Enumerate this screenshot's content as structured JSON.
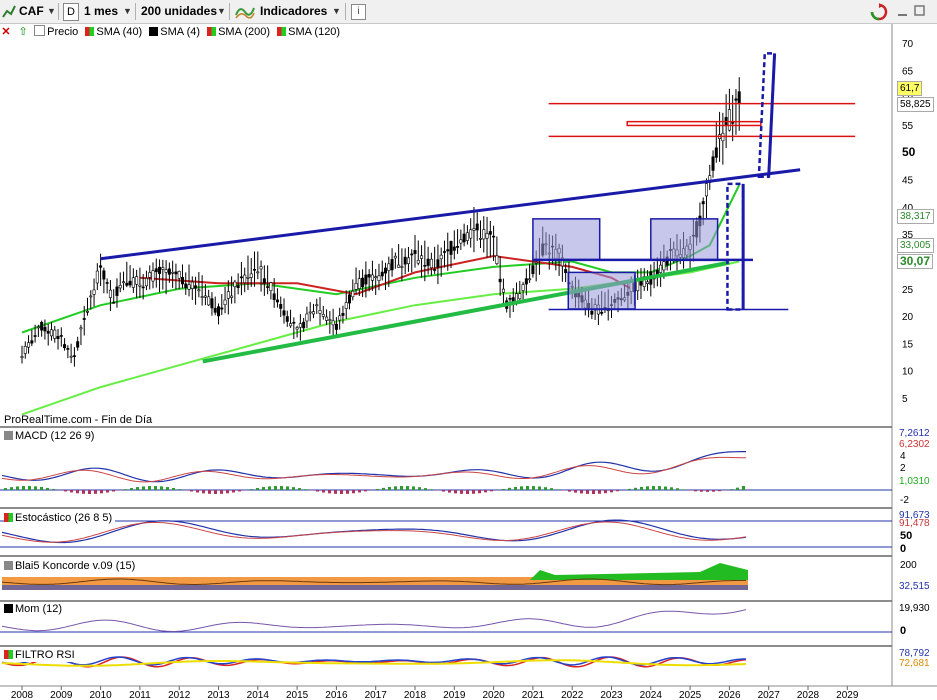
{
  "toolbar": {
    "symbol": "CAF",
    "period_letter": "D",
    "timeframe": "1 mes",
    "units": "200 unidades",
    "indicators_label": "Indicadores",
    "info_icon": "info-icon"
  },
  "legend": {
    "price": "Precio",
    "sma40": "SMA (40)",
    "sma4": "SMA (4)",
    "sma200": "SMA (200)",
    "sma120": "SMA (120)"
  },
  "watermark": "ProRealTime.com - Fin de Día",
  "panels": {
    "macd": {
      "title": "MACD (12 26 9)",
      "v1": "7,2612",
      "v2": "6,2302",
      "v3": "1,0310",
      "ticks": [
        "4",
        "2",
        "0",
        "-2"
      ]
    },
    "stoch": {
      "title": "Estocástico (26 8 5)",
      "v1": "91,673",
      "v2": "91,478",
      "ticks": [
        "50",
        "0"
      ]
    },
    "konc": {
      "title": "Blai5 Koncorde v.09 (15)",
      "v1": "32,515",
      "ticks": [
        "200",
        "0"
      ]
    },
    "mom": {
      "title": "Mom (12)",
      "v1": "19,930",
      "ticks": [
        "0"
      ]
    },
    "rsi": {
      "title": "FILTRO RSI",
      "v1": "78,792",
      "v2": "72,681"
    }
  },
  "colors": {
    "price_bar": "#000000",
    "sma40": "#22cc22",
    "sma200": "#66ee44",
    "sma120": "#cc2222",
    "trend": "#1a1aa8",
    "resistance": "#dd1111",
    "box": "#9999dd",
    "last_price_bg": "#ffff66"
  },
  "chart_data": {
    "type": "line",
    "title": "",
    "y_axis_ticks": [
      5,
      10,
      15,
      20,
      25,
      30,
      35,
      40,
      45,
      50,
      55,
      60,
      65,
      70
    ],
    "ylim": [
      0,
      72
    ],
    "x_axis_years": [
      "2008",
      "2009",
      "2010",
      "2011",
      "2012",
      "2013",
      "2014",
      "2015",
      "2016",
      "2017",
      "2018",
      "2019",
      "2020",
      "2021",
      "2022",
      "2023",
      "2024",
      "2025",
      "2026",
      "2027",
      "2028",
      "2029"
    ],
    "last_price": "61,7",
    "price_labels": [
      "58,825",
      "38,317",
      "33,005",
      "30,07"
    ],
    "series": [
      {
        "name": "Precio",
        "x": [
          2008.0,
          2008.5,
          2009.0,
          2009.3,
          2009.7,
          2010.0,
          2010.3,
          2010.6,
          2011.0,
          2011.5,
          2012.0,
          2012.5,
          2013.0,
          2013.5,
          2014.0,
          2014.5,
          2015.0,
          2015.5,
          2016.0,
          2016.5,
          2017.0,
          2017.5,
          2018.0,
          2018.5,
          2019.0,
          2019.5,
          2020.0,
          2020.3,
          2020.7,
          2021.0,
          2021.3,
          2021.7,
          2022.0,
          2022.5,
          2023.0,
          2023.5,
          2024.0,
          2024.5,
          2025.0,
          2025.3,
          2025.6,
          2026.0,
          2026.25
        ],
        "y": [
          13,
          18,
          16,
          12,
          22,
          29,
          23,
          27,
          26,
          28,
          27,
          25,
          21,
          26,
          29,
          23,
          17,
          22,
          18,
          26,
          27,
          30,
          31,
          29,
          33,
          36,
          34,
          22,
          24,
          29,
          33,
          31,
          25,
          21,
          22,
          25,
          27,
          31,
          32,
          39,
          49,
          56,
          60
        ]
      },
      {
        "name": "SMA (40)",
        "x": [
          2008.0,
          2010.0,
          2012.0,
          2014.0,
          2016.0,
          2018.0,
          2020.0,
          2022.0,
          2023.0,
          2024.0,
          2025.0,
          2025.5,
          2026.25
        ],
        "y": [
          17,
          22,
          25,
          26,
          24,
          27,
          29,
          30,
          28,
          28,
          31,
          33,
          44
        ]
      },
      {
        "name": "SMA (200)",
        "x": [
          2008.0,
          2010.0,
          2012.0,
          2014.0,
          2016.0,
          2018.0,
          2020.0,
          2022.0,
          2024.0,
          2025.0,
          2026.25
        ],
        "y": [
          2,
          7,
          11,
          15,
          19,
          22,
          24,
          25,
          27,
          28,
          30
        ]
      },
      {
        "name": "SMA (120)",
        "x": [
          2011.0,
          2013.0,
          2015.0,
          2016.5,
          2018.0,
          2020.0,
          2021.0,
          2022.0,
          2023.0,
          2023.5
        ],
        "y": [
          27,
          26,
          26,
          24,
          28,
          31,
          30,
          29,
          27,
          25
        ]
      }
    ]
  }
}
